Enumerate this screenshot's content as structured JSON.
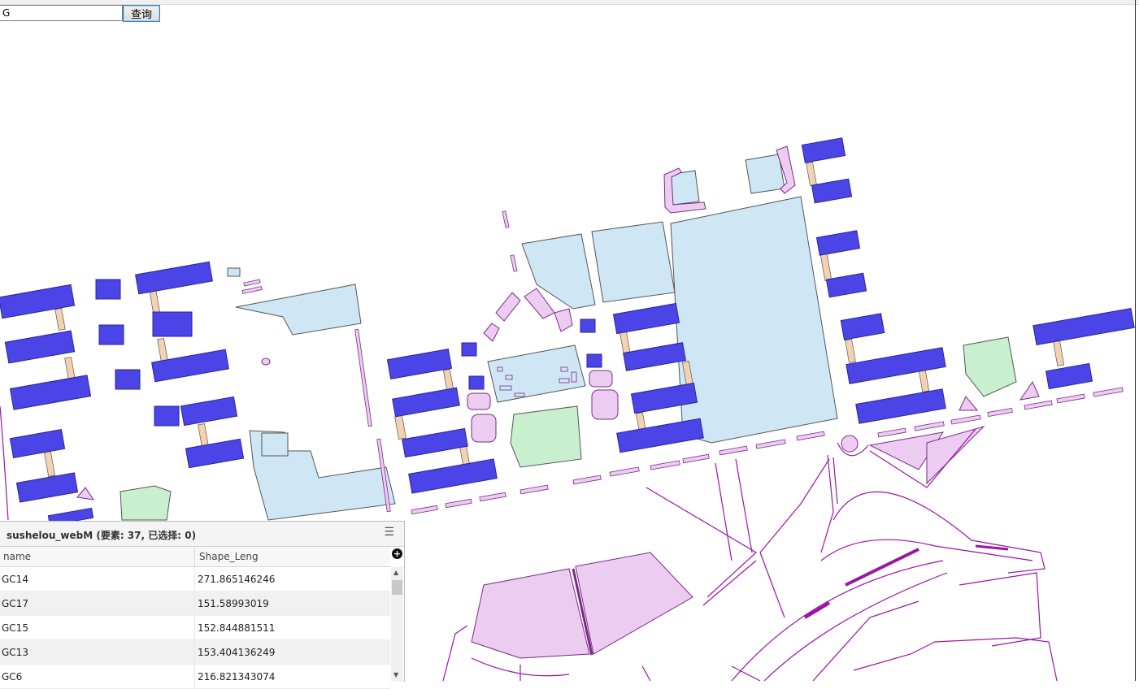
{
  "search": {
    "value": "G"
  },
  "query_button": {
    "label": "查询"
  },
  "colors": {
    "building": "#4b45e8",
    "building_stroke": "#2a239a",
    "water_blue": "#cfe6f5",
    "pink": "#eccdf1",
    "green": "#c8f0cf",
    "tan": "#f3d2b0",
    "road_line": "#9a15a4"
  },
  "attribute_table": {
    "title": "sushelou_webM (要素: 37, 已选择: 0)",
    "menu_icon": "hamburger-icon",
    "columns": [
      "name",
      "Shape_Leng"
    ],
    "rows": [
      {
        "name": "GC14",
        "shape_leng": "271.865146246"
      },
      {
        "name": "GC17",
        "shape_leng": "151.58993019"
      },
      {
        "name": "GC15",
        "shape_leng": "152.844881511"
      },
      {
        "name": "GC13",
        "shape_leng": "153.404136249"
      },
      {
        "name": "GC6",
        "shape_leng": "216.821343074"
      }
    ]
  }
}
